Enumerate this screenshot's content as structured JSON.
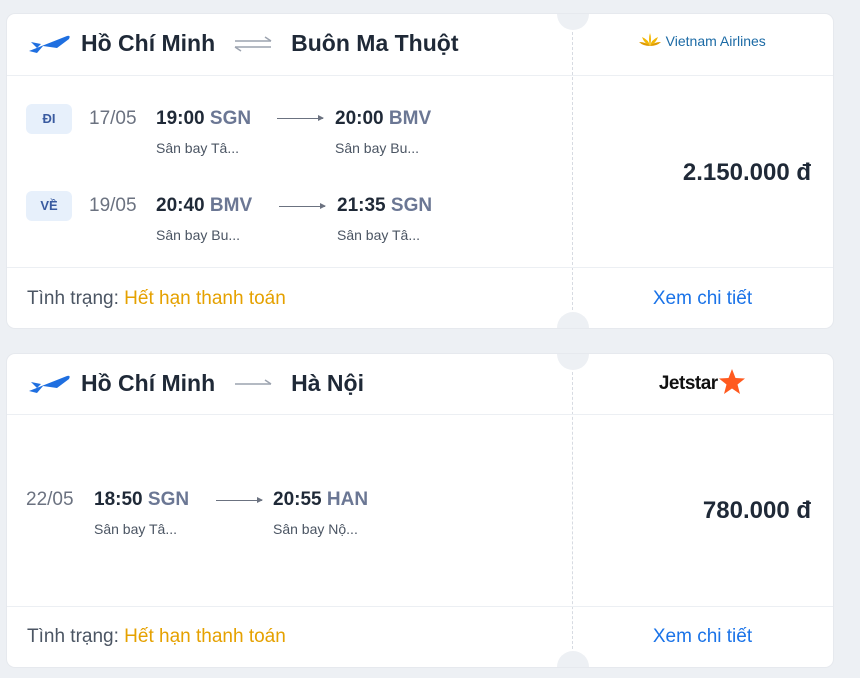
{
  "bookings": [
    {
      "origin": "Hồ Chí Minh",
      "destination": "Buôn Ma Thuột",
      "airline": "Vietnam Airlines",
      "price": "2.150.000 đ",
      "status_label": "Tình trạng:",
      "status_value": "Hết hạn thanh toán",
      "detail_label": "Xem chi tiết",
      "legs": [
        {
          "tag": "ĐI",
          "date": "17/05",
          "dep_time": "19:00",
          "dep_code": "SGN",
          "dep_airport": "Sân bay Tâ...",
          "arr_time": "20:00",
          "arr_code": "BMV",
          "arr_airport": "Sân bay Bu..."
        },
        {
          "tag": "VỀ",
          "date": "19/05",
          "dep_time": "20:40",
          "dep_code": "BMV",
          "dep_airport": "Sân bay Bu...",
          "arr_time": "21:35",
          "arr_code": "SGN",
          "arr_airport": "Sân bay Tâ..."
        }
      ]
    },
    {
      "origin": "Hồ Chí Minh",
      "destination": "Hà Nội",
      "airline": "Jetstar",
      "price": "780.000 đ",
      "status_label": "Tình trạng:",
      "status_value": "Hết hạn thanh toán",
      "detail_label": "Xem chi tiết",
      "legs": [
        {
          "date": "22/05",
          "dep_time": "18:50",
          "dep_code": "SGN",
          "dep_airport": "Sân bay Tâ...",
          "arr_time": "20:55",
          "arr_code": "HAN",
          "arr_airport": "Sân bay Nộ..."
        }
      ]
    }
  ],
  "colors": {
    "accent": "#1a73e8",
    "status": "#e5a100",
    "tag_bg": "#e7f0fb",
    "airport_code": "#6b7794"
  },
  "icons": [
    "plane-icon",
    "round-trip-arrows-icon",
    "one-way-arrow-icon",
    "vietnam-airlines-lotus-icon",
    "jetstar-star-icon"
  ]
}
